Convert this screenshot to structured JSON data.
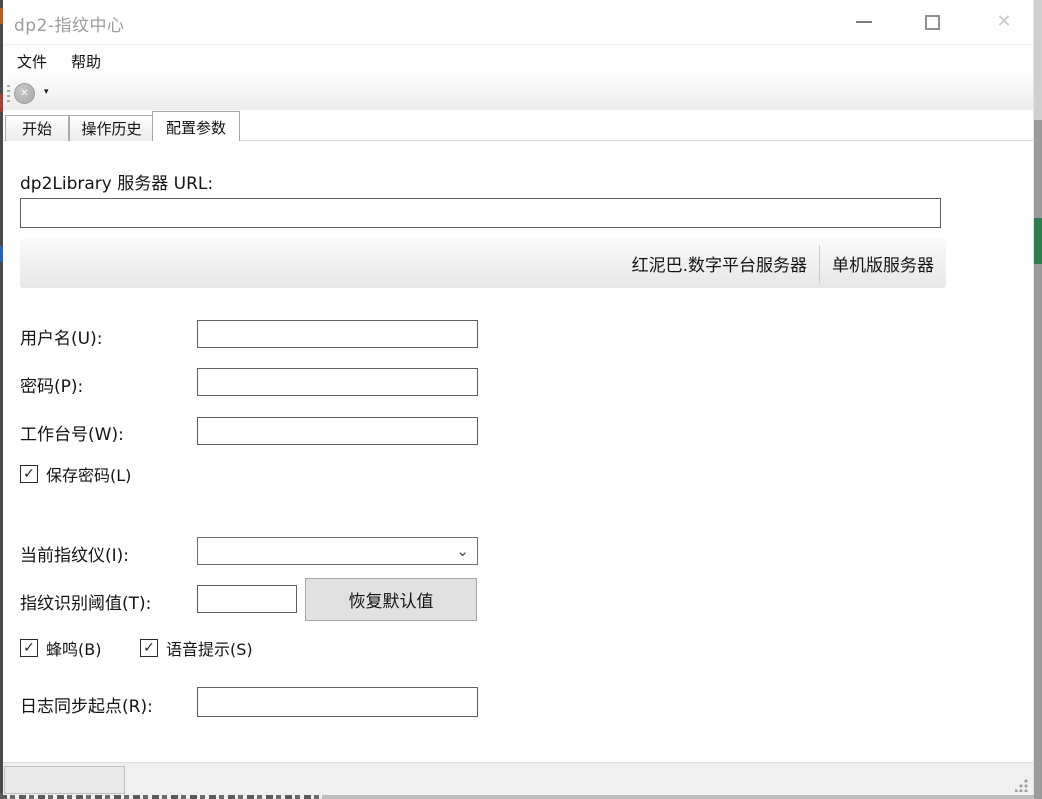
{
  "window": {
    "title": "dp2-指纹中心"
  },
  "menu": {
    "file": "文件",
    "help": "帮助"
  },
  "tabs": [
    {
      "label": "开始",
      "selected": false
    },
    {
      "label": "操作历史",
      "selected": false
    },
    {
      "label": "配置参数",
      "selected": true
    }
  ],
  "form": {
    "url_label": "dp2Library 服务器 URL:",
    "url_value": "",
    "server_buttons": {
      "hongniba": "红泥巴.数字平台服务器",
      "standalone": "单机版服务器"
    },
    "fields": [
      {
        "label": "用户名(U):",
        "value": ""
      },
      {
        "label": "密码(P):",
        "value": ""
      },
      {
        "label": "工作台号(W):",
        "value": ""
      }
    ],
    "save_password": {
      "label": "保存密码(L)",
      "checked": true
    },
    "reader_label": "当前指纹仪(I):",
    "reader_value": "",
    "threshold_label": "指纹识别阈值(T):",
    "threshold_value": "",
    "reset_button": "恢复默认值",
    "beep": {
      "label": "蜂鸣(B)",
      "checked": true
    },
    "voice": {
      "label": "语音提示(S)",
      "checked": true
    },
    "log_label": "日志同步起点(R):",
    "log_value": ""
  },
  "icons": {
    "minimize": "—",
    "maximize": "□",
    "close": "✕",
    "toolbar_stop": "✕",
    "dropdown": "▾",
    "check": "✓",
    "combo_chevron": "⌄"
  },
  "colors": {
    "title_inactive": "#9c9d9e",
    "input_border": "#5f5f5f",
    "button_face": "#e1e1e1",
    "button_border": "#a6a6a6",
    "band_gradient_bottom": "#e7e7e7",
    "statusbar": "#f0f0f0",
    "behind_green": "#2e7d4f"
  }
}
